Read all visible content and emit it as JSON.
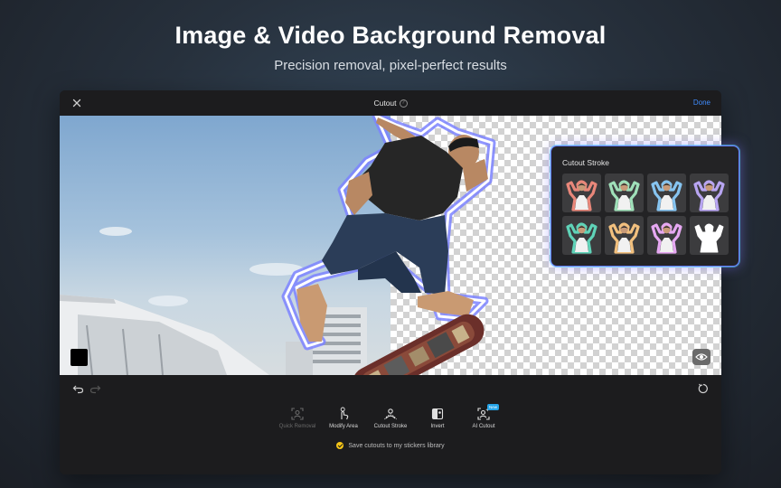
{
  "hero": {
    "title": "Image & Video Background Removal",
    "subtitle": "Precision removal, pixel-perfect results"
  },
  "toolbar": {
    "title": "Cutout",
    "info_glyph": "?",
    "done_label": "Done",
    "close_icon": "close-icon"
  },
  "panel": {
    "title": "Cutout Stroke",
    "styles": [
      {
        "name": "red-stroke",
        "color": "#e9877a"
      },
      {
        "name": "green-stroke",
        "color": "#9fe0b9"
      },
      {
        "name": "blue-stroke",
        "color": "#86c4f0"
      },
      {
        "name": "purple-stroke",
        "color": "#b8a5f2"
      },
      {
        "name": "mint-stroke",
        "color": "#5fd3b8"
      },
      {
        "name": "orange-stroke",
        "color": "#f2c07e"
      },
      {
        "name": "pink-stroke",
        "color": "#e6a8f2"
      },
      {
        "name": "white-silhouette",
        "color": "#ffffff"
      }
    ]
  },
  "tools": [
    {
      "label": "Quick Removal",
      "icon": "person-scan-icon",
      "disabled": true
    },
    {
      "label": "Modify Area",
      "icon": "hand-touch-icon",
      "disabled": false
    },
    {
      "label": "Cutout Stroke",
      "icon": "stroke-person-icon",
      "disabled": false
    },
    {
      "label": "Invert",
      "icon": "invert-icon",
      "disabled": false
    },
    {
      "label": "AI Cutout",
      "icon": "ai-person-icon",
      "disabled": false,
      "badge": "New"
    }
  ],
  "save_option": {
    "label": "Save cutouts to my stickers library",
    "checked": true
  },
  "colors": {
    "accent": "#3f8cff",
    "stroke": "#6d7cff",
    "check": "#f5c518"
  }
}
